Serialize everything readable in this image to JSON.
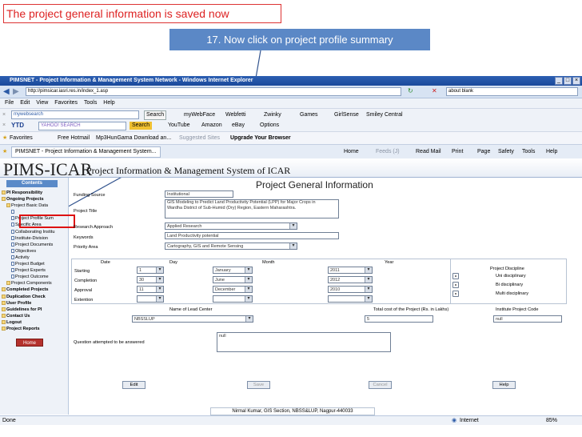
{
  "slide": {
    "note": "The project general information is saved now",
    "step": "17. Now click on project profile summary"
  },
  "window": {
    "title": "PIMSNET - Project Information & Management System Network - Windows Internet Explorer",
    "address": "http://pimsicar.iasri.res.in/index_1.asp",
    "right_search": "about blank"
  },
  "menu": [
    "File",
    "Edit",
    "View",
    "Favorites",
    "Tools",
    "Help"
  ],
  "toolbar1": {
    "search_box": "mywebsearch",
    "search_btn": "Search",
    "items": [
      "myWebFace",
      "Webfetti",
      "Zwinky",
      "Games",
      "GirlSense",
      "Smiley Central"
    ]
  },
  "toolbar2": {
    "ytd": "YTD",
    "search_btn": "Search",
    "items": [
      "YouTube",
      "Amazon",
      "eBay",
      "Options"
    ]
  },
  "favbar": {
    "favorites": "Favorites",
    "items": [
      "Free Hotmail",
      "Mp3HunGama Download an...",
      "Suggested Sites",
      "Upgrade Your Browser"
    ]
  },
  "tabbar": {
    "tab": "PIMSNET - Project Information & Management System...",
    "right": [
      "Home",
      "Feeds (J)",
      "Read Mail",
      "Print",
      "Page",
      "Safety",
      "Tools",
      "Help"
    ]
  },
  "header": {
    "logo": "PIMS-ICAR",
    "subtitle": "Project Information & Management System of ICAR"
  },
  "sidebar": {
    "heading": "Contents",
    "items": [
      "PI Responsibility",
      "Ongoing Projects",
      "Project Basic Data",
      "",
      "Project Profile Sum",
      "Specific Area",
      "Collaborating Institu",
      "Institute-Division",
      "Project Documents",
      "Objectives",
      "Activity",
      "Project Budget",
      "Project Experts",
      "Project Outcome",
      "Project Components",
      "Completed Projects",
      "Duplication Check",
      "User Profile",
      "Guidelines for PI",
      "Contact Us",
      "Logout",
      "Project Reports"
    ],
    "home": "Home"
  },
  "form": {
    "title": "Project General Information",
    "funding_label": "Funding Source",
    "funding_value": "Institutional",
    "project_title_label": "Project Title",
    "project_title_value": "GIS Modeling to Predict Land Productivity Potential (LPP) for Major Crops in Wardha District of Sub-Humid (Dry) Region, Eastern Maharashtra.",
    "approach_label": "Research Approach",
    "approach_value": "Applied Research",
    "keywords_label": "Keywords",
    "keywords_value": "Land Productivity potential",
    "priority_label": "Priority Area",
    "priority_value": "Cartography, GIS and Remote Sensing",
    "col_date": "Date",
    "col_day": "Day",
    "col_month": "Month",
    "col_year": "Year",
    "rows": [
      {
        "label": "Starting",
        "day": "1",
        "month": "January",
        "year": "2011"
      },
      {
        "label": "Completion",
        "day": "30",
        "month": "June",
        "year": "2012"
      },
      {
        "label": "Approval",
        "day": "11",
        "month": "December",
        "year": "2010"
      },
      {
        "label": "Extention",
        "day": "",
        "month": "",
        "year": ""
      }
    ],
    "discipline_label": "Project Discipline",
    "disciplines": [
      "Uni disciplinary",
      "Bi disciplinary",
      "Multi disciplinary"
    ],
    "lead_center_label": "Name of Lead Center",
    "lead_center_value": "NBSSLUP",
    "total_cost_label": "Total cost of the Project (Rs. in Lakhs)",
    "total_cost_value": "5",
    "institute_code_label": "Institute Project Code",
    "institute_code_value": "null",
    "question_label": "Question attempted to be answered",
    "question_value": "null",
    "buttons": [
      "Edit",
      "Save",
      "Cancel",
      "Help"
    ],
    "credit": "Nirmal Kumar, GIS Section, NBSS&LUP, Nagpur-440033"
  },
  "status": {
    "left": "Done",
    "zone": "Internet",
    "zoom": "85%"
  }
}
